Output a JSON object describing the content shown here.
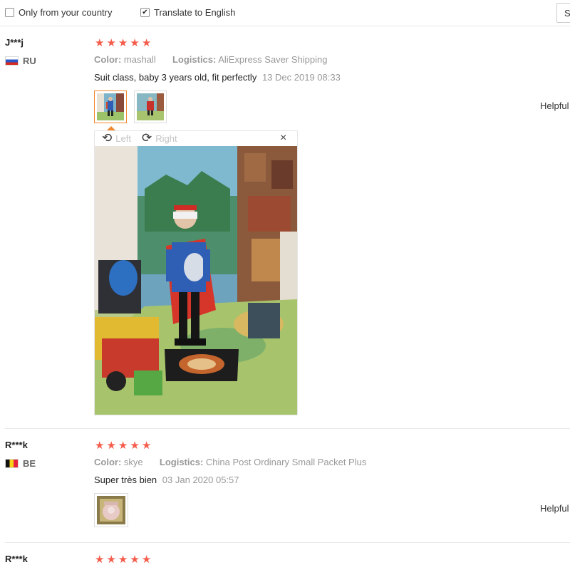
{
  "filters": {
    "only_country_label": "Only from your country",
    "only_country_checked": false,
    "translate_label": "Translate to English",
    "translate_checked": true,
    "sort_label": "S"
  },
  "labels": {
    "color": "Color:",
    "logistics": "Logistics:",
    "helpful": "Helpful"
  },
  "viewer": {
    "rotate_left_label": "Left",
    "rotate_right_label": "Right",
    "close_glyph": "×",
    "rotate_left_icon": "rotate-left-icon",
    "rotate_right_icon": "rotate-right-icon"
  },
  "reviews": [
    {
      "name": "J***j",
      "country": "RU",
      "stars": 5,
      "color": "mashall",
      "logistics": "AliExpress Saver Shipping",
      "text": "Suit class, baby 3 years old, fit perfectly",
      "date": "13 Dec 2019 08:33",
      "images": 2
    },
    {
      "name": "R***k",
      "country": "BE",
      "stars": 5,
      "color": "skye",
      "logistics": "China Post Ordinary Small Packet Plus",
      "text": "Super très bien",
      "date": "03 Jan 2020 05:57",
      "images": 1
    },
    {
      "name": "R***k",
      "stars": 5
    }
  ],
  "star_glyph": "★",
  "check_glyph": "✔",
  "colors": {
    "star": "#f45c4b",
    "active_thumb_border": "#f0882f",
    "muted_text": "#999999"
  }
}
